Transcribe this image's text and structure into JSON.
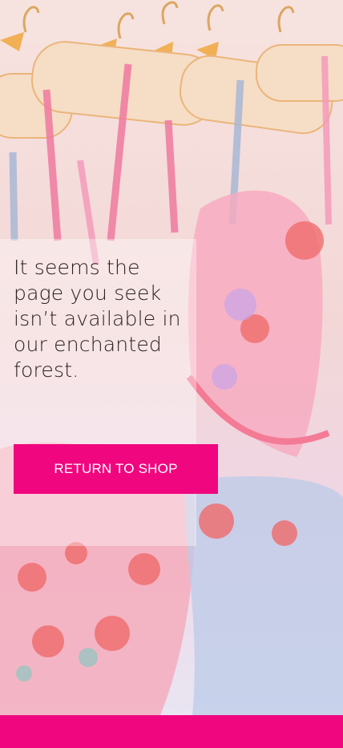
{
  "notfound": {
    "message": "It seems the page you seek isn’t available in our enchanted forest.",
    "cta_label": "RETURN TO SHOP"
  },
  "colors": {
    "accent": "#f0077f",
    "text": "#2a2020"
  }
}
